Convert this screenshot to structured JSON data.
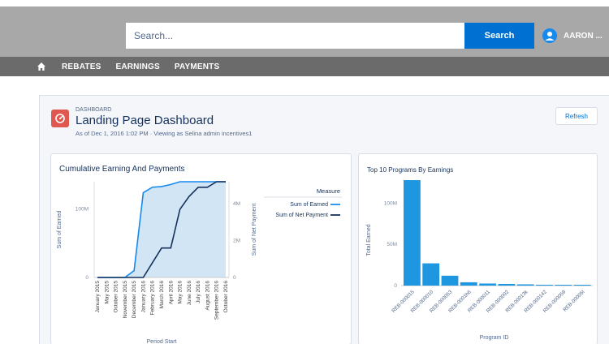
{
  "header": {
    "search_placeholder": "Search...",
    "search_button": "Search",
    "user_name": "AARON ..."
  },
  "nav": {
    "items": [
      {
        "label": "REBATES"
      },
      {
        "label": "EARNINGS"
      },
      {
        "label": "PAYMENTS"
      }
    ]
  },
  "dashboard": {
    "eyebrow": "DASHBOARD",
    "title": "Landing Page Dashboard",
    "meta": "As of Dec 1, 2016 1:02 PM · Viewing as Selina admin incentives1",
    "refresh_label": "Refresh"
  },
  "colors": {
    "accent": "#0070d2",
    "earned_line": "#1589ee",
    "net_payment_line": "#16325c",
    "area_fill": "#c9e1f2",
    "bar_fill": "#1e97e0",
    "dashboard_icon": "#e0574f"
  },
  "chart_data": [
    {
      "type": "line",
      "title": "Cumulative Earning And Payments",
      "xlabel": "Period Start",
      "ylabel": "Sum of Earned",
      "ylabel_right": "Sum of Net Payment",
      "legend_title": "Measure",
      "legend_position": "right",
      "x": [
        "January 2015",
        "May 2015",
        "October 2015",
        "November 2015",
        "December 2015",
        "January 2016",
        "February 2016",
        "March 2016",
        "April 2016",
        "May 2016",
        "June 2016",
        "July 2016",
        "August 2016",
        "September 2016",
        "October 2016"
      ],
      "y_ticks": [
        "0",
        "100M"
      ],
      "y_right_ticks": [
        "0",
        "2M",
        "4M"
      ],
      "ylim": [
        0,
        140
      ],
      "ylim_right": [
        0,
        5.2
      ],
      "series": [
        {
          "name": "Sum of Earned",
          "axis": "left",
          "values": [
            0,
            0,
            0,
            0,
            10,
            124,
            132,
            133,
            136,
            140,
            140,
            140,
            140,
            140,
            140
          ]
        },
        {
          "name": "Sum of Net Payment",
          "axis": "right",
          "values": [
            0,
            0,
            0,
            0,
            0,
            0,
            0.8,
            1.6,
            1.6,
            3.7,
            4.4,
            4.9,
            4.9,
            5.2,
            5.2
          ]
        }
      ],
      "grid": false
    },
    {
      "type": "bar",
      "title": "Top 10 Programs By Earnings",
      "xlabel": "Program ID",
      "ylabel": "Total Earned",
      "categories": [
        "REB-000015",
        "REB-000010",
        "REB-000053",
        "REB-0001h6",
        "REB-000011",
        "REB-000002",
        "REB-00013k",
        "REB-000142",
        "REB-000059",
        "REB-00005t"
      ],
      "y_ticks": [
        "0",
        "50M",
        "100M"
      ],
      "values": [
        128,
        27,
        12,
        4,
        2.5,
        2,
        1.5,
        1,
        1,
        1
      ],
      "ylim": [
        0,
        130
      ],
      "grid": false
    }
  ]
}
